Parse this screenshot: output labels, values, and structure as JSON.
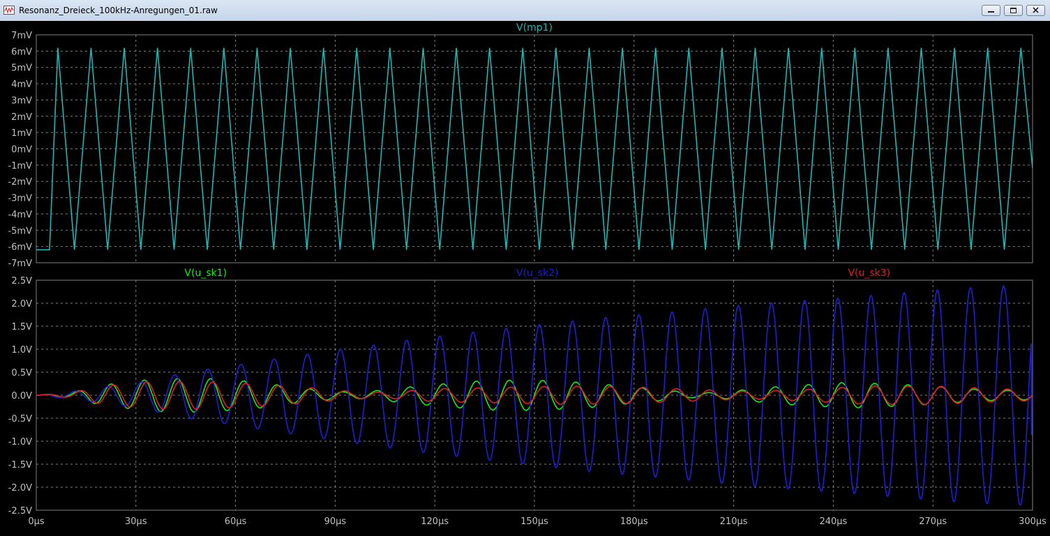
{
  "window": {
    "title": "Resonanz_Dreieck_100kHz-Anregungen_01.raw",
    "buttons": [
      "minimize",
      "maximize",
      "close"
    ],
    "icons": {
      "app": "waveform-icon",
      "minimize": "minimize-icon",
      "maximize": "maximize-icon",
      "close": "close-icon"
    }
  },
  "colors": {
    "background": "#000000",
    "grid": "#808080",
    "axis_text": "#c0c0c0",
    "mp1": "#1fb5b5",
    "u_sk1": "#10ee10",
    "u_sk2": "#1e1ed8",
    "u_sk3": "#e81c1c"
  },
  "chart_data": [
    {
      "type": "line",
      "x_axis": {
        "range": [
          0,
          300
        ],
        "unit": "µs",
        "ticks": [
          0,
          30,
          60,
          90,
          120,
          150,
          180,
          210,
          240,
          270,
          300
        ],
        "tick_labels": [
          "0µs",
          "30µs",
          "60µs",
          "90µs",
          "120µs",
          "150µs",
          "180µs",
          "210µs",
          "240µs",
          "270µs",
          "300µs"
        ]
      },
      "y_axis": {
        "range": [
          -7,
          7
        ],
        "unit": "mV",
        "ticks": [
          7,
          6,
          5,
          4,
          3,
          2,
          1,
          0,
          -1,
          -2,
          -3,
          -4,
          -5,
          -6,
          -7
        ],
        "tick_labels": [
          "7mV",
          "6mV",
          "5mV",
          "4mV",
          "3mV",
          "2mV",
          "1mV",
          "0mV",
          "-1mV",
          "-2mV",
          "-3mV",
          "-4mV",
          "-5mV",
          "-6mV",
          "-7mV"
        ]
      },
      "grid": true,
      "series": [
        {
          "name": "V(mp1)",
          "color_key": "mp1",
          "waveform": "triangle",
          "frequency_khz": 100,
          "amplitude_mv": 6.2,
          "offset_mv": 0,
          "start": {
            "hold_until_us": 4,
            "initial_mv": -6.2
          },
          "first_peak_us": 6.5,
          "end_value_mv": -1.2
        }
      ]
    },
    {
      "type": "line",
      "x_axis": {
        "range": [
          0,
          300
        ],
        "unit": "µs",
        "ticks": [
          0,
          30,
          60,
          90,
          120,
          150,
          180,
          210,
          240,
          270,
          300
        ],
        "tick_labels": [
          "0µs",
          "30µs",
          "60µs",
          "90µs",
          "120µs",
          "150µs",
          "180µs",
          "210µs",
          "240µs",
          "270µs",
          "300µs"
        ]
      },
      "y_axis": {
        "range": [
          -2.5,
          2.5
        ],
        "unit": "V",
        "ticks": [
          2.5,
          2.0,
          1.5,
          1.0,
          0.5,
          0.0,
          -0.5,
          -1.0,
          -1.5,
          -2.0,
          -2.5
        ],
        "tick_labels": [
          "2.5V",
          "2.0V",
          "1.5V",
          "1.0V",
          "0.5V",
          "0.0V",
          "-0.5V",
          "-1.0V",
          "-1.5V",
          "-2.0V",
          "-2.5V"
        ]
      },
      "grid": true,
      "series": [
        {
          "name": "V(u_sk1)",
          "color_key": "u_sk1",
          "frequency_khz": 100,
          "envelope_peaks": [
            [
              0,
              0
            ],
            [
              10,
              0.05
            ],
            [
              20,
              0.22
            ],
            [
              35,
              0.35
            ],
            [
              50,
              0.37
            ],
            [
              65,
              0.3
            ],
            [
              80,
              0.15
            ],
            [
              93,
              0.07
            ],
            [
              100,
              0.08
            ],
            [
              115,
              0.2
            ],
            [
              135,
              0.32
            ],
            [
              150,
              0.33
            ],
            [
              165,
              0.28
            ],
            [
              185,
              0.14
            ],
            [
              198,
              0.05
            ],
            [
              205,
              0.06
            ],
            [
              225,
              0.2
            ],
            [
              245,
              0.28
            ],
            [
              265,
              0.22
            ],
            [
              285,
              0.12
            ],
            [
              300,
              0.1
            ]
          ]
        },
        {
          "name": "V(u_sk2)",
          "color_key": "u_sk2",
          "frequency_khz": 100,
          "envelope_peaks": [
            [
              0,
              0
            ],
            [
              10,
              0.07
            ],
            [
              20,
              0.18
            ],
            [
              30,
              0.26
            ],
            [
              40,
              0.42
            ],
            [
              50,
              0.55
            ],
            [
              60,
              0.65
            ],
            [
              70,
              0.77
            ],
            [
              80,
              0.87
            ],
            [
              90,
              0.98
            ],
            [
              100,
              1.08
            ],
            [
              110,
              1.18
            ],
            [
              120,
              1.27
            ],
            [
              130,
              1.36
            ],
            [
              140,
              1.44
            ],
            [
              150,
              1.52
            ],
            [
              160,
              1.6
            ],
            [
              170,
              1.68
            ],
            [
              180,
              1.74
            ],
            [
              190,
              1.8
            ],
            [
              200,
              1.87
            ],
            [
              210,
              1.94
            ],
            [
              220,
              2.0
            ],
            [
              230,
              2.05
            ],
            [
              240,
              2.1
            ],
            [
              250,
              2.16
            ],
            [
              260,
              2.22
            ],
            [
              270,
              2.28
            ],
            [
              280,
              2.33
            ],
            [
              290,
              2.37
            ],
            [
              300,
              2.4
            ]
          ],
          "end_value_v": -0.85
        },
        {
          "name": "V(u_sk3)",
          "color_key": "u_sk3",
          "frequency_khz": 100,
          "envelope_peaks": [
            [
              0,
              0
            ],
            [
              10,
              0.05
            ],
            [
              20,
              0.2
            ],
            [
              35,
              0.3
            ],
            [
              50,
              0.3
            ],
            [
              65,
              0.25
            ],
            [
              80,
              0.18
            ],
            [
              95,
              0.08
            ],
            [
              105,
              0.06
            ],
            [
              120,
              0.14
            ],
            [
              140,
              0.17
            ],
            [
              160,
              0.2
            ],
            [
              180,
              0.18
            ],
            [
              200,
              0.12
            ],
            [
              215,
              0.08
            ],
            [
              230,
              0.12
            ],
            [
              250,
              0.2
            ],
            [
              270,
              0.2
            ],
            [
              290,
              0.14
            ],
            [
              300,
              0.12
            ]
          ]
        }
      ]
    }
  ]
}
